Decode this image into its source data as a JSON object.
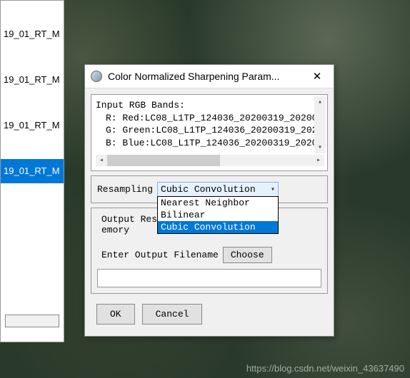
{
  "left_panel": {
    "items": [
      {
        "label": "19_01_RT_M"
      },
      {
        "label": "19_01_RT_M"
      },
      {
        "label": "19_01_RT_M"
      },
      {
        "label": "19_01_RT_M",
        "selected": true
      }
    ]
  },
  "dialog": {
    "title": "Color Normalized Sharpening Param...",
    "close": "✕",
    "bands": {
      "header": "Input RGB Bands:",
      "r": "R: Red:LC08_L1TP_124036_20200319_20200",
      "g": "G: Green:LC08_L1TP_124036_20200319_2020",
      "b": "B: Blue:LC08_L1TP_124036_20200319_20200"
    },
    "resampling": {
      "label": "Resampling",
      "selected": "Cubic Convolution",
      "options": [
        "Nearest Neighbor",
        "Bilinear",
        "Cubic Convolution"
      ]
    },
    "output": {
      "label_left": "Output Res",
      "label_right": "emory",
      "filename_label": "Enter Output Filename",
      "choose": "Choose"
    },
    "footer": {
      "ok": "OK",
      "cancel": "Cancel"
    }
  },
  "watermark": "https://blog.csdn.net/weixin_43637490"
}
